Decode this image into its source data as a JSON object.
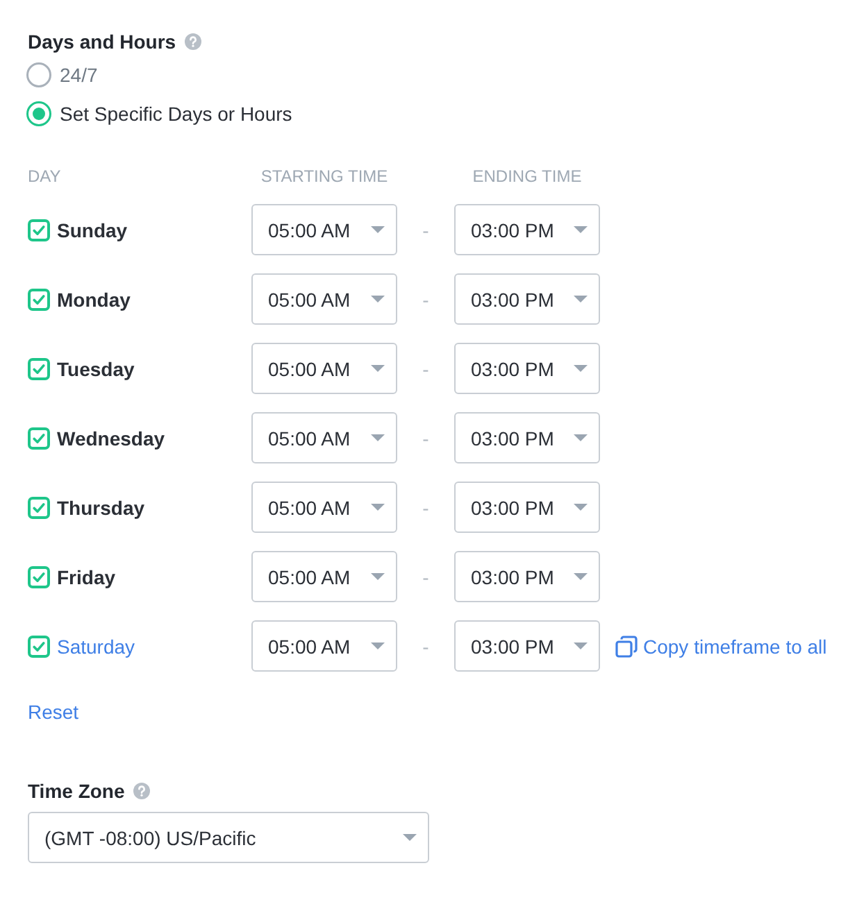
{
  "days_and_hours": {
    "title": "Days and Hours",
    "options": [
      {
        "label": "24/7",
        "selected": false
      },
      {
        "label": "Set Specific Days or Hours",
        "selected": true
      }
    ]
  },
  "schedule": {
    "columns": [
      "DAY",
      "STARTING TIME",
      "ENDING TIME"
    ],
    "days": [
      {
        "name": "Sunday",
        "checked": true,
        "selected": false,
        "start": "05:00 AM",
        "separator": "-",
        "end": "03:00 PM"
      },
      {
        "name": "Monday",
        "checked": true,
        "selected": false,
        "start": "05:00 AM",
        "separator": "-",
        "end": "03:00 PM"
      },
      {
        "name": "Tuesday",
        "checked": true,
        "selected": false,
        "start": "05:00 AM",
        "separator": "-",
        "end": "03:00 PM"
      },
      {
        "name": "Wednesday",
        "checked": true,
        "selected": false,
        "start": "05:00 AM",
        "separator": "-",
        "end": "03:00 PM"
      },
      {
        "name": "Thursday",
        "checked": true,
        "selected": false,
        "start": "05:00 AM",
        "separator": "-",
        "end": "03:00 PM"
      },
      {
        "name": "Friday",
        "checked": true,
        "selected": false,
        "start": "05:00 AM",
        "separator": "-",
        "end": "03:00 PM"
      },
      {
        "name": "Saturday",
        "checked": true,
        "selected": true,
        "start": "05:00 AM",
        "separator": "-",
        "end": "03:00 PM",
        "action": "Copy timeframe to all"
      }
    ]
  },
  "reset": "Reset",
  "time_zone": {
    "label": "Time Zone",
    "value": "(GMT -08:00) US/Pacific"
  }
}
